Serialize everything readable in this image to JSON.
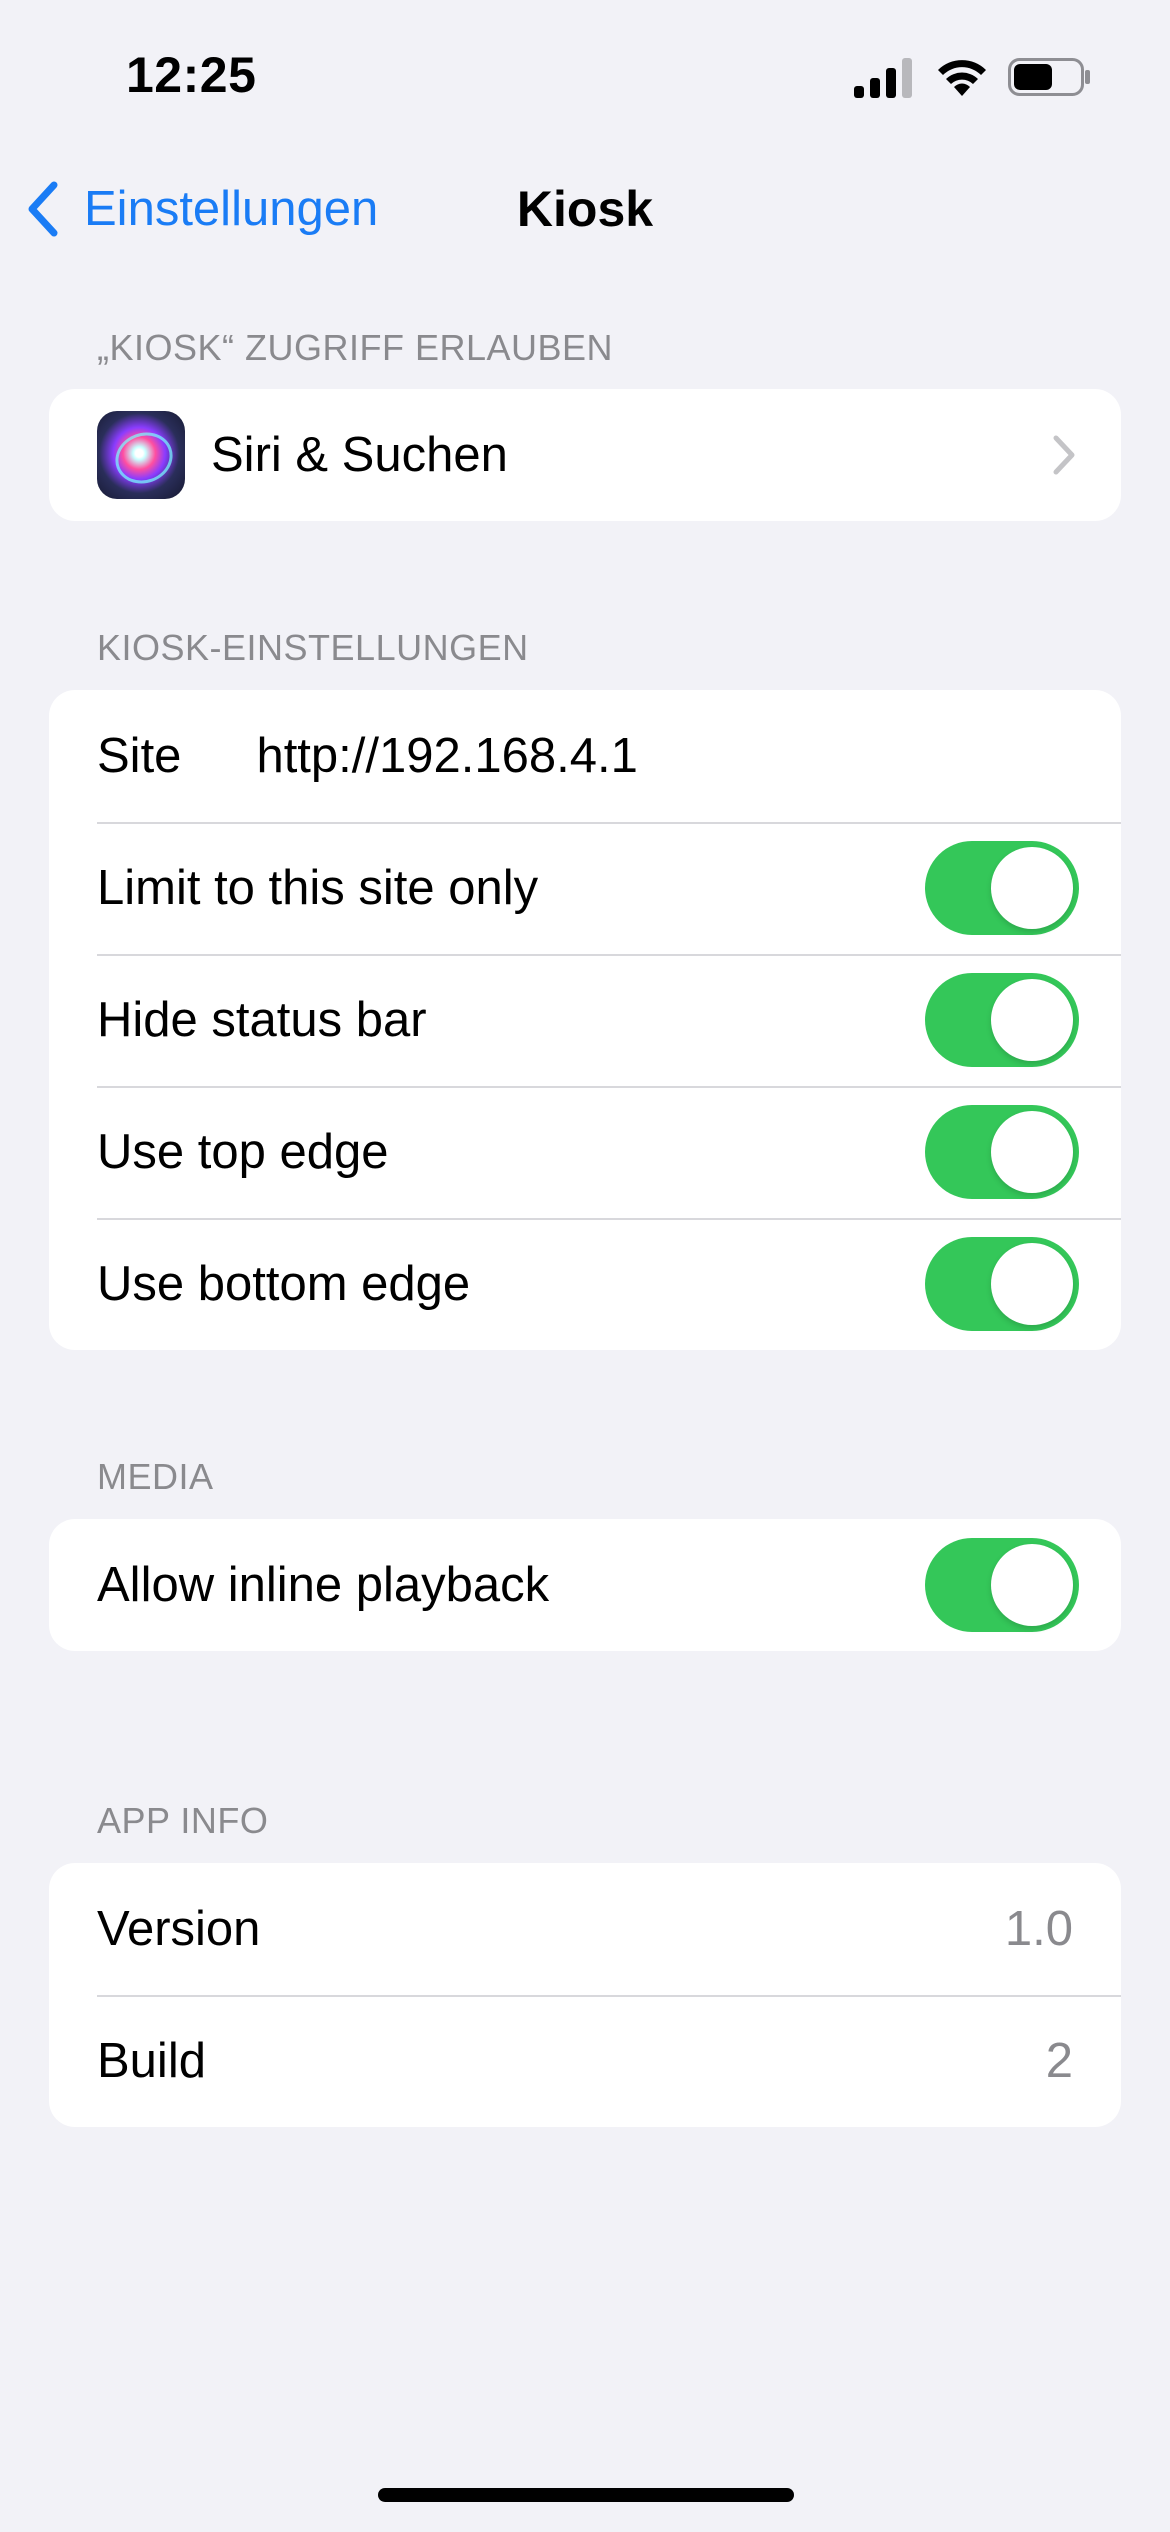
{
  "status_bar": {
    "time": "12:25",
    "signal_icon": "cellular-signal-icon",
    "wifi_icon": "wifi-icon",
    "battery_icon": "battery-icon",
    "battery_level": 0.6
  },
  "nav": {
    "back_label": "Einstellungen",
    "title": "Kiosk"
  },
  "sections": {
    "access": {
      "header": "„KIOSK“ ZUGRIFF ERLAUBEN",
      "siri_label": "Siri & Suchen"
    },
    "kiosk_settings": {
      "header": "KIOSK-EINSTELLUNGEN",
      "site_label": "Site",
      "site_value": "http://192.168.4.1",
      "toggles": [
        {
          "label": "Limit to this site only",
          "on": true
        },
        {
          "label": "Hide status bar",
          "on": true
        },
        {
          "label": "Use top edge",
          "on": true
        },
        {
          "label": "Use bottom edge",
          "on": true
        }
      ]
    },
    "media": {
      "header": "MEDIA",
      "toggles": [
        {
          "label": "Allow inline playback",
          "on": true
        }
      ]
    },
    "app_info": {
      "header": "APP INFO",
      "version_label": "Version",
      "version_value": "1.0",
      "build_label": "Build",
      "build_value": "2"
    }
  },
  "colors": {
    "accent": "#1a7cf5",
    "toggle_on": "#34c759",
    "background": "#f2f2f7",
    "secondary_text": "#8a8a8e"
  }
}
